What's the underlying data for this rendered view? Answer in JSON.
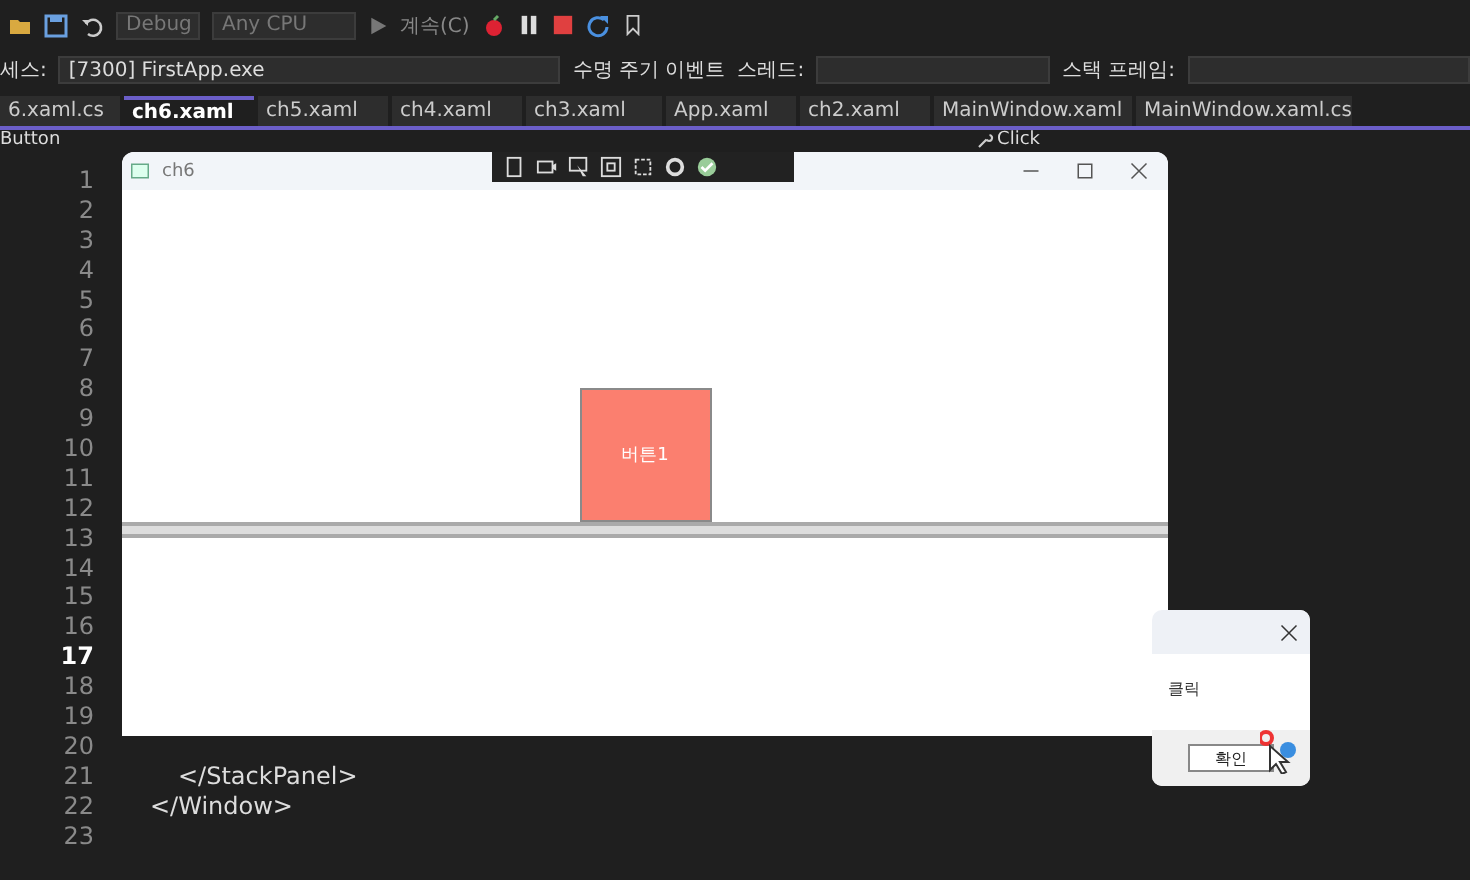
{
  "toolbar": {
    "configuration": "Debug",
    "platform": "Any CPU",
    "continue": "계속(C)"
  },
  "debug_bar": {
    "process_label": "세스:",
    "process": "[7300] FirstApp.exe",
    "lifecycle": "수명 주기 이벤트",
    "thread_label": "스레드:",
    "stack_label": "스택 프레임:"
  },
  "tabs": [
    {
      "label": "6.xaml.cs",
      "selected": false
    },
    {
      "label": "ch6.xaml",
      "selected": true
    },
    {
      "label": "ch5.xaml",
      "selected": false
    },
    {
      "label": "ch4.xaml",
      "selected": false
    },
    {
      "label": "ch3.xaml",
      "selected": false
    },
    {
      "label": "App.xaml",
      "selected": false
    },
    {
      "label": "ch2.xaml",
      "selected": false
    },
    {
      "label": "MainWindow.xaml",
      "selected": false
    },
    {
      "label": "MainWindow.xaml.cs",
      "selected": false
    }
  ],
  "nav_bar": {
    "element": "Button",
    "member": "Click"
  },
  "editor": {
    "lines": [
      {
        "number": "1",
        "current": false
      },
      {
        "number": "2",
        "current": false
      },
      {
        "number": "3",
        "current": false
      },
      {
        "number": "4",
        "current": false
      },
      {
        "number": "5",
        "current": false
      },
      {
        "number": "6",
        "current": false
      },
      {
        "number": "7",
        "current": false
      },
      {
        "number": "8",
        "current": false
      },
      {
        "number": "9",
        "current": false
      },
      {
        "number": "10",
        "current": false
      },
      {
        "number": "11",
        "current": false
      },
      {
        "number": "12",
        "current": false
      },
      {
        "number": "13",
        "current": false
      },
      {
        "number": "14",
        "current": false
      },
      {
        "number": "15",
        "current": false
      },
      {
        "number": "16",
        "current": false
      },
      {
        "number": "17",
        "current": true
      },
      {
        "number": "18",
        "current": false
      },
      {
        "number": "19",
        "current": false
      },
      {
        "number": "20",
        "current": false
      },
      {
        "number": "21",
        "current": false,
        "code": "</StackPanel>",
        "indent": true
      },
      {
        "number": "22",
        "current": false,
        "code": "</Window>",
        "indent": false
      },
      {
        "number": "23",
        "current": false
      }
    ]
  },
  "app_window": {
    "title": "ch6",
    "button": "버튼1"
  },
  "message_box": {
    "message": "클릭",
    "button": "확인"
  }
}
